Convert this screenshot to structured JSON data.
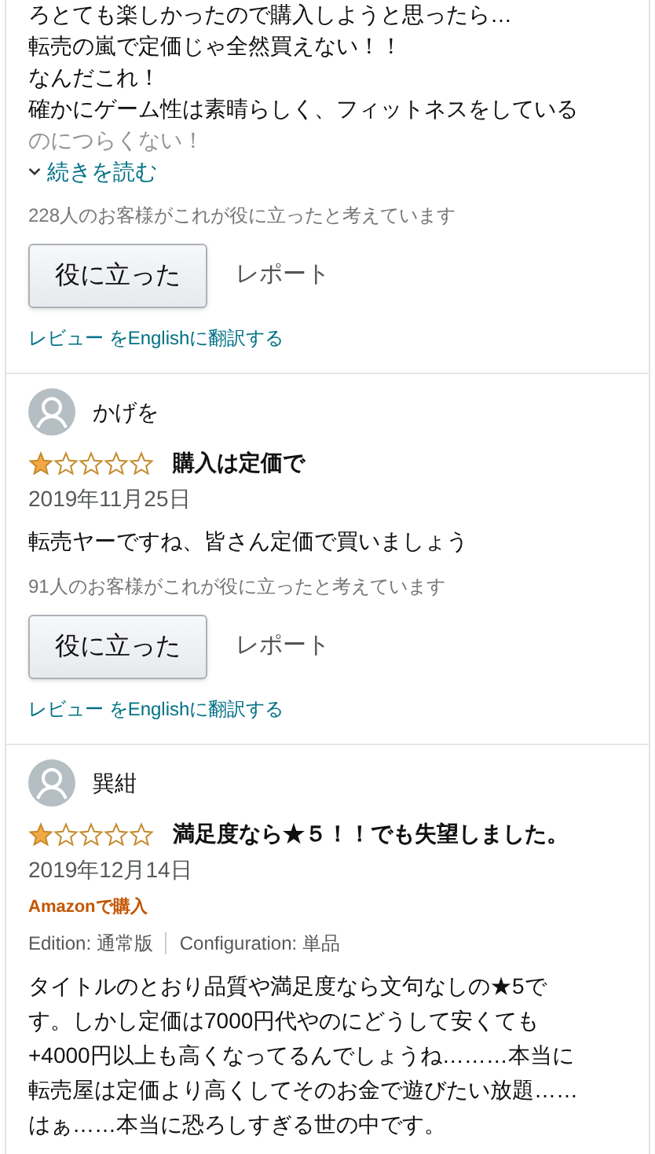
{
  "reviews": [
    {
      "body_lines": [
        "ろとても楽しかったので購入しようと思ったら…",
        "転売の嵐で定価じゃ全然買えない！！",
        "なんだこれ！",
        "確かにゲーム性は素晴らしく、フィットネスをしている",
        "のにつらくない！"
      ],
      "read_more": "続きを読む",
      "helpful_count": "228人のお客様がこれが役に立ったと考えています",
      "helpful_button": "役に立った",
      "report": "レポート",
      "translate": "レビュー をEnglishに翻訳する"
    },
    {
      "author": "かげを",
      "stars": 1,
      "title": "購入は定価で",
      "date": "2019年11月25日",
      "body_lines": [
        "転売ヤーですね、皆さん定価で買いましょう"
      ],
      "helpful_count": "91人のお客様がこれが役に立ったと考えています",
      "helpful_button": "役に立った",
      "report": "レポート",
      "translate": "レビュー をEnglishに翻訳する"
    },
    {
      "author": "巽紺",
      "stars": 1,
      "title": "満足度なら★５！！でも失望しました。",
      "date": "2019年12月14日",
      "verified": "Amazonで購入",
      "variants": [
        "Edition: 通常版",
        "Configuration: 単品"
      ],
      "body_lines": [
        "タイトルのとおり品質や満足度なら文句なしの★5で",
        "す。しかし定価は7000円代やのにどうして安くても",
        "+4000円以上も高くなってるんでしょうね………本当に",
        "転売屋は定価より高くしてそのお金で遊びたい放題……",
        "はぁ……本当に恐ろしすぎる世の中です。"
      ]
    }
  ]
}
